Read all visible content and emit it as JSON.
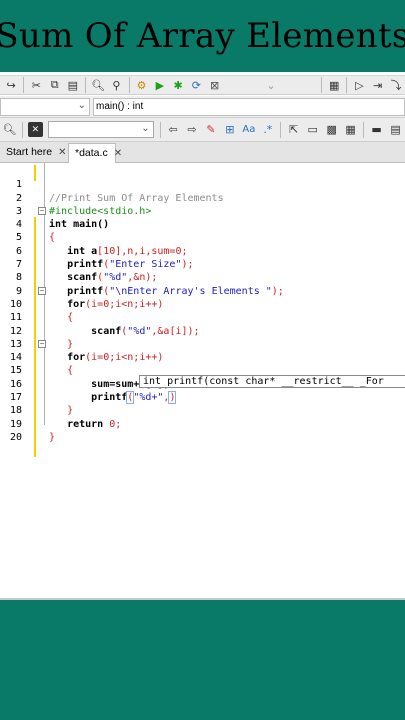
{
  "banner": {
    "title": "Sum Of Array Elements"
  },
  "toolbar": {
    "function_scope": "main() : int"
  },
  "tabs": [
    {
      "label": "Start here",
      "close": "✕"
    },
    {
      "label": "*data.c",
      "close": "✕"
    }
  ],
  "editor": {
    "line_numbers": [
      "1",
      "2",
      "3",
      "4",
      "5",
      "6",
      "7",
      "8",
      "9",
      "10",
      "11",
      "12",
      "13",
      "14",
      "15",
      "16",
      "17",
      "18",
      "19",
      "20"
    ],
    "tooltip": "int printf(const char* __restrict__ _For"
  },
  "code": {
    "l1": "//Print Sum Of Array Elements",
    "l2": "#include<stdio.h>",
    "l3_kw": "int",
    "l3_rest": " main()",
    "l4": "{",
    "l5_kw": "int",
    "l5_a": " a",
    "l5_b": "[",
    "l5_n": "10",
    "l5_c": "],n,i,sum=",
    "l5_z": "0",
    "l5_e": ";",
    "l6_f": "printf",
    "l6_p": "(",
    "l6_s": "\"Enter Size\"",
    "l6_e": ");",
    "l7_f": "scanf",
    "l7_p": "(",
    "l7_s": "\"%d\"",
    "l7_e": ",&n);",
    "l8_f": "printf",
    "l8_p": "(",
    "l8_s": "\"\\nEnter Array's Elements \"",
    "l8_e": ");",
    "l9_kw": "for",
    "l9_a": "(i=",
    "l9_z": "0",
    "l9_b": ";i<n;i++)",
    "l10": "{",
    "l11_f": "scanf",
    "l11_p": "(",
    "l11_s": "\"%d\"",
    "l11_e": ",&a[i]);",
    "l12": "}",
    "l13_kw": "for",
    "l13_a": "(i=",
    "l13_z": "0",
    "l13_b": ";i<n;i++)",
    "l14": "{",
    "l15": "sum=sum+a[i];",
    "l16_f": "printf",
    "l16_p": "(",
    "l16_s": "\"%d+\"",
    "l16_e": ",",
    "l17": "}",
    "l18_kw": "return",
    "l18_z": " 0",
    "l18_e": ";",
    "l19": "}"
  }
}
